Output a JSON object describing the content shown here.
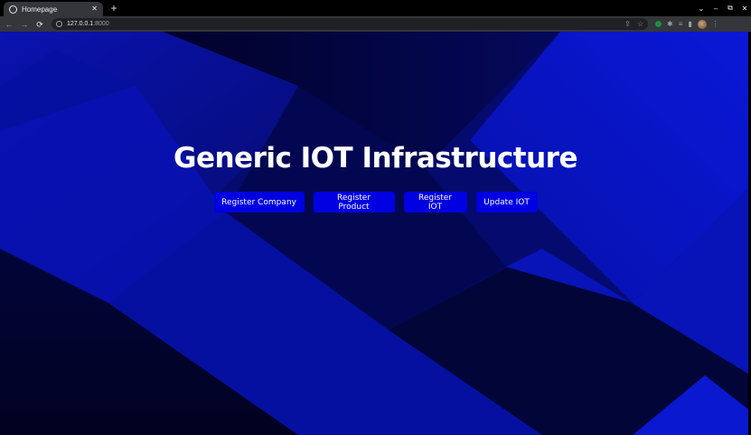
{
  "browser": {
    "tab": {
      "title": "Homepage",
      "favicon": "globe-icon",
      "close_glyph": "✕"
    },
    "new_tab_glyph": "+",
    "window_controls": {
      "tab_search": "⌄",
      "minimize": "–",
      "restore": "⧉",
      "close": "✕"
    },
    "nav": {
      "back": "←",
      "forward": "→",
      "reload": "⟳"
    },
    "address_bar": {
      "host": "127.0.0.1",
      "port": ":8000"
    },
    "omnibox_icons": {
      "share": "⇪",
      "bookmark": "☆"
    },
    "extension_icons": {
      "puzzle": "✱",
      "media": "≡",
      "sidepanel": "▮",
      "menu": "⋮"
    }
  },
  "page": {
    "title": "Generic IOT Infrastructure",
    "buttons": {
      "register_company": "Register Company",
      "register_product": "Register Product",
      "register_iot": "Register IOT",
      "update_iot": "Update IOT"
    },
    "colors": {
      "background_base": "#050a6e",
      "button_bg": "#0000e0",
      "title_text": "#ffffff"
    }
  }
}
